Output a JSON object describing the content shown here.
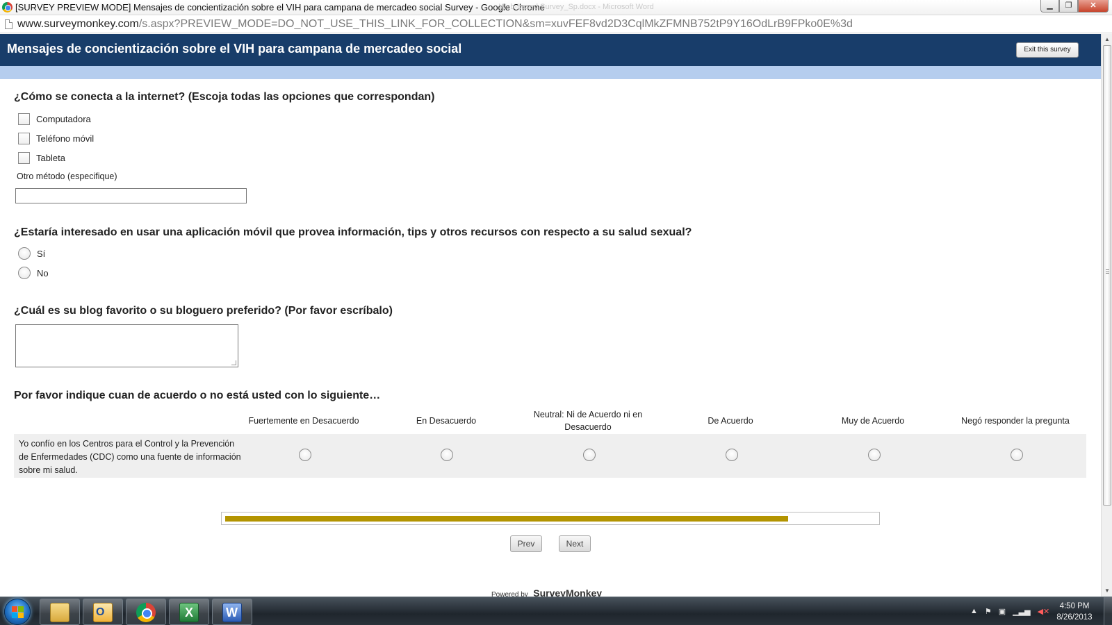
{
  "window": {
    "title": "[SURVEY PREVIEW MODE] Mensajes de concientización sobre el VIH para campana de mercadeo social Survey - Google Chrome",
    "ghost_title": "Web-based Survey_Sp.docx - Microsoft Word",
    "minimize_glyph": "▁",
    "restore_glyph": "❐",
    "close_glyph": "✕"
  },
  "urlbar": {
    "host": "www.surveymonkey.com",
    "path": "/s.aspx?PREVIEW_MODE=DO_NOT_USE_THIS_LINK_FOR_COLLECTION&sm=xuvFEF8vd2D3CqlMkZFMNB752tP9Y16OdLrB9FPko0E%3d"
  },
  "header": {
    "title": "Mensajes de concientización sobre el VIH para campana de mercadeo social",
    "exit_label": "Exit this survey",
    "colors": {
      "bar": "#183d6a",
      "stripe": "#b5cdee"
    }
  },
  "q1": {
    "title": "¿Cómo se conecta a la internet? (Escoja todas las opciones que correspondan)",
    "options": [
      "Computadora",
      "Teléfono móvil",
      "Tableta"
    ],
    "other_label": "Otro método (especifique)",
    "other_value": ""
  },
  "q2": {
    "title": "¿Estaría interesado en usar una aplicación móvil que provea información, tips y otros recursos con respecto a su salud sexual?",
    "options": [
      "Sí",
      "No"
    ]
  },
  "q3": {
    "title": "¿Cuál es su blog favorito o su bloguero preferido? (Por favor escríbalo)",
    "value": ""
  },
  "q4": {
    "title": "Por favor indique cuan de acuerdo o no está usted con lo siguiente…",
    "columns": [
      "Fuertemente en Desacuerdo",
      "En Desacuerdo",
      "Neutral: Ni de Acuerdo ni en Desacuerdo",
      "De Acuerdo",
      "Muy de Acuerdo",
      "Negó responder la pregunta"
    ],
    "row_label": "Yo confío en los Centros para el Control y la Prevención de Enfermedades (CDC) como una fuente de información sobre mi salud."
  },
  "progress": {
    "fraction": 0.865,
    "color": "#b39400"
  },
  "nav": {
    "prev_label": "Prev",
    "next_label": "Next"
  },
  "footer": {
    "powered_by": "Powered by",
    "brand": "SurveyMonkey"
  },
  "taskbar": {
    "apps": [
      "folder-icon",
      "outlook-icon",
      "chrome-icon",
      "excel-icon",
      "word-icon"
    ],
    "tray_icons": [
      "show-hidden-icon",
      "flag-icon",
      "network-icon",
      "signal-icon",
      "volume-muted-icon"
    ],
    "time": "4:50 PM",
    "date": "8/26/2013"
  }
}
